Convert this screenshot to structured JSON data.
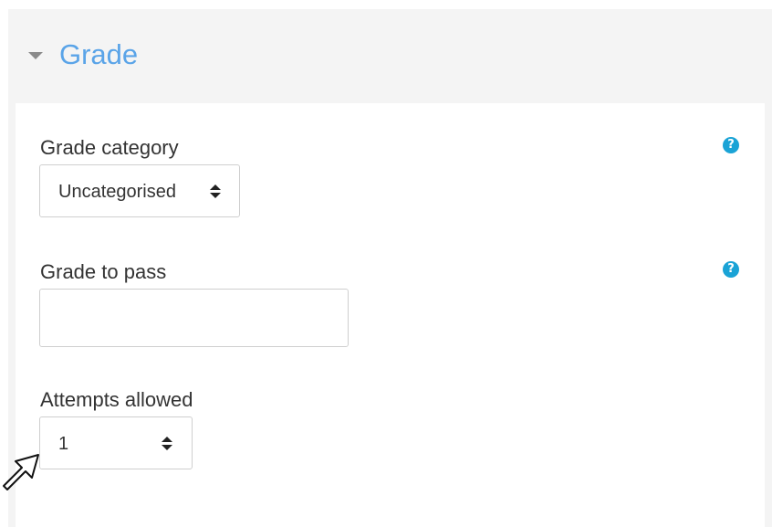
{
  "section": {
    "title": "Grade",
    "collapse_icon": "caret-down-icon"
  },
  "fields": {
    "grade_category": {
      "label": "Grade category",
      "value": "Uncategorised",
      "help_icon": "help-icon",
      "help_glyph": "?"
    },
    "grade_to_pass": {
      "label": "Grade to pass",
      "value": "",
      "help_icon": "help-icon",
      "help_glyph": "?"
    },
    "attempts_allowed": {
      "label": "Attempts allowed",
      "value": "1"
    }
  },
  "colors": {
    "title": "#5aa4e8",
    "help": "#1aa3d6",
    "header_bg": "#f4f4f4"
  },
  "cursor_icon": "mouse-pointer-icon"
}
